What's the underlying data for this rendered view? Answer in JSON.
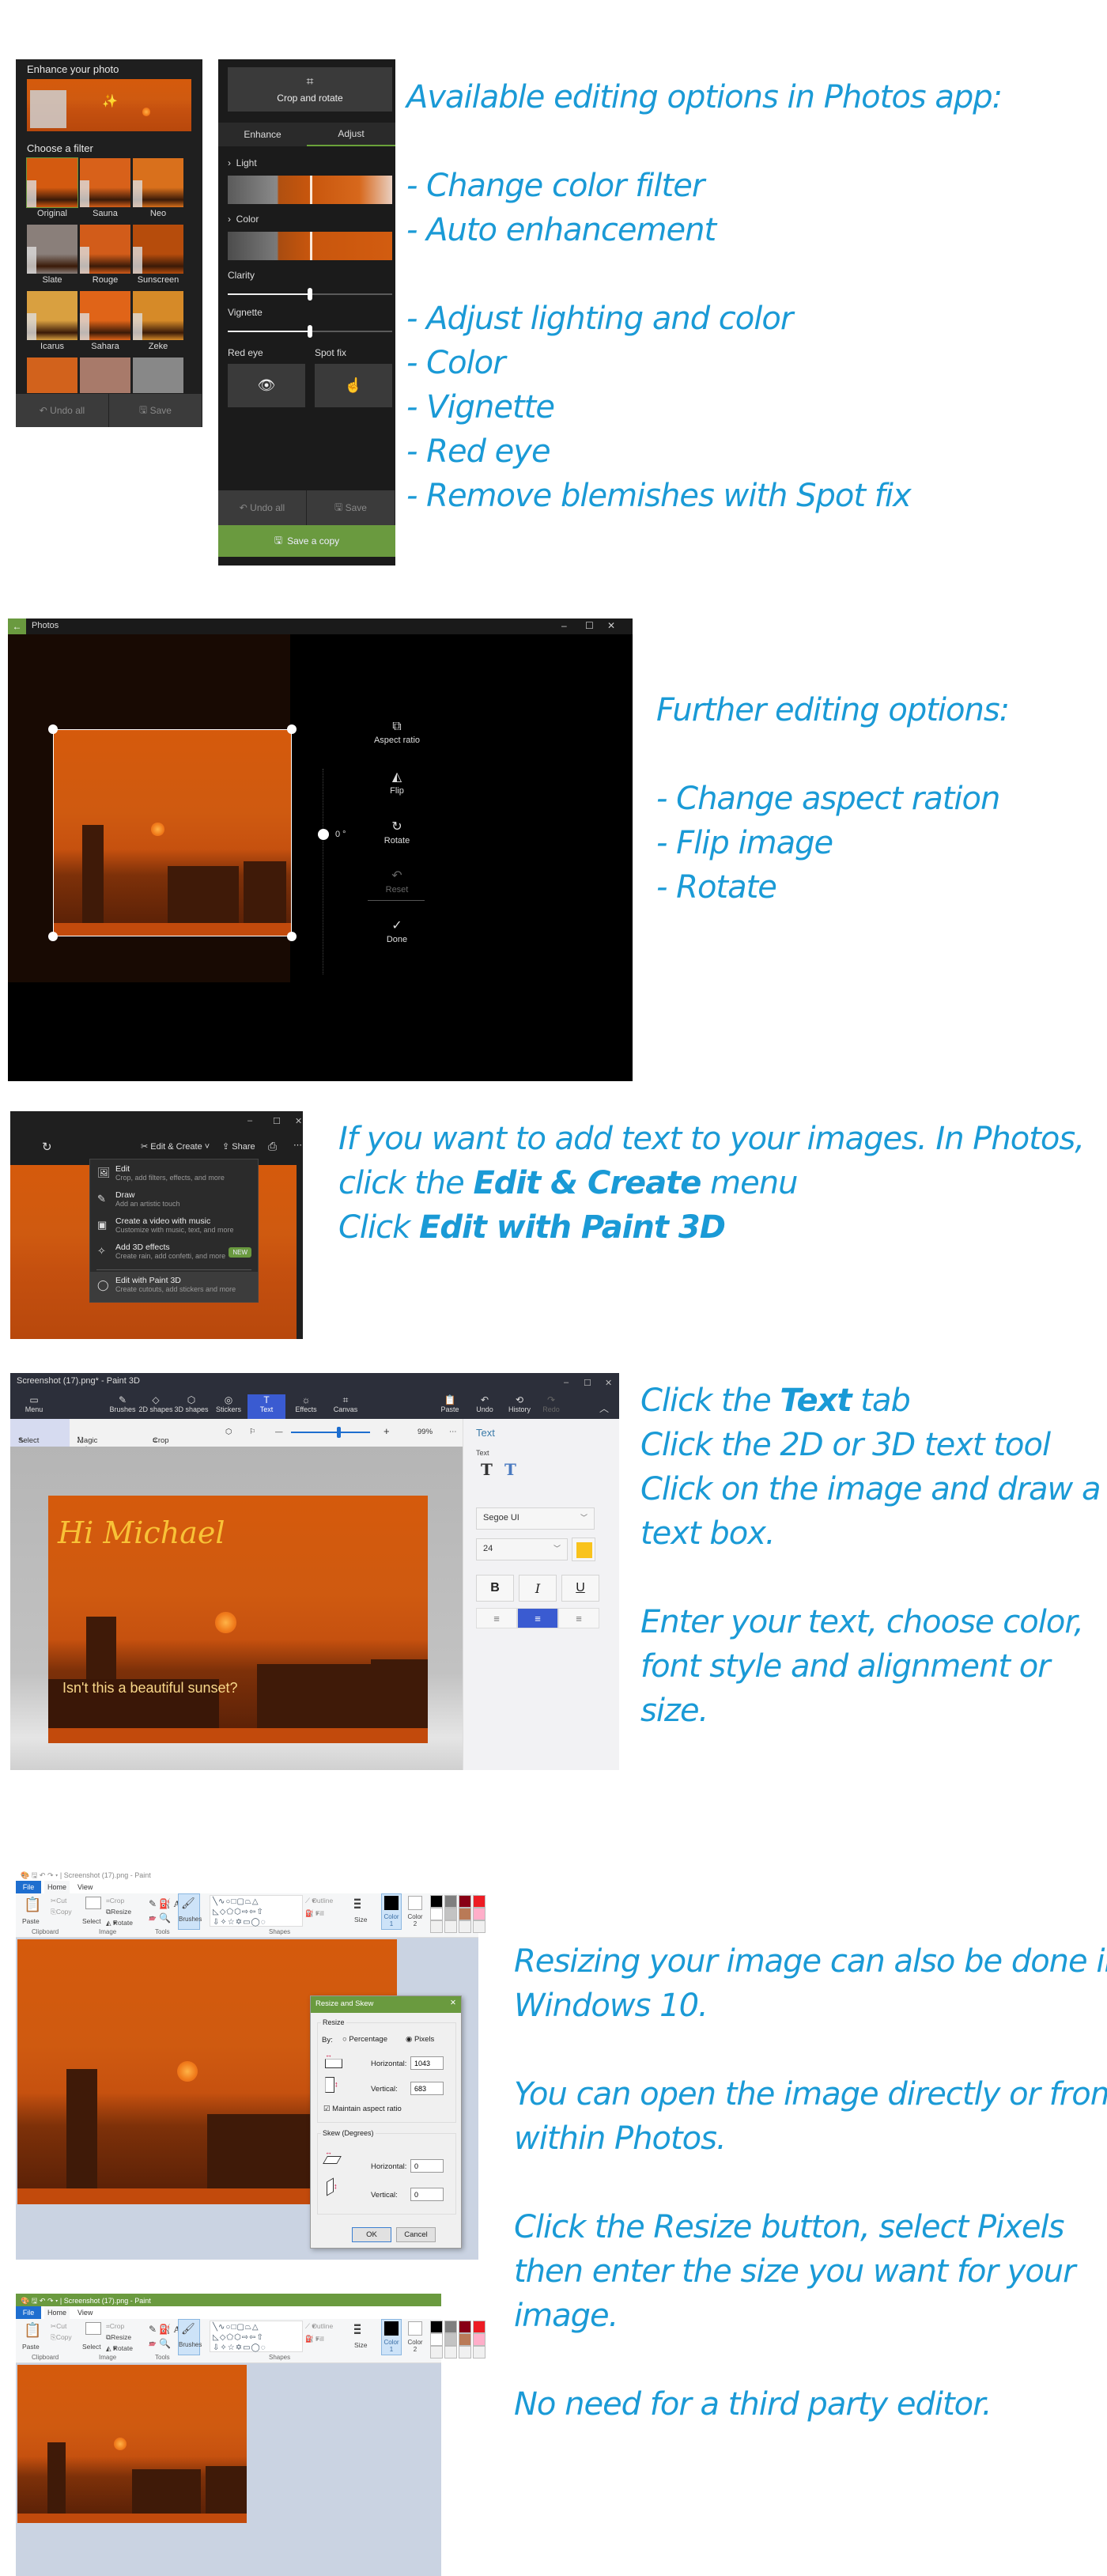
{
  "section1": {
    "filter_panel": {
      "title": "Enhance your photo",
      "choose_filter": "Choose a filter",
      "filters": [
        "Original",
        "Sauna",
        "Neo",
        "Slate",
        "Rouge",
        "Sunscreen",
        "Icarus",
        "Sahara",
        "Zeke"
      ],
      "undo_all": "Undo all",
      "save": "Save"
    },
    "adjust_panel": {
      "crop_rotate": "Crop and rotate",
      "tabs": [
        "Enhance",
        "Adjust"
      ],
      "active_tab": "Adjust",
      "light": "Light",
      "color": "Color",
      "clarity": "Clarity",
      "clarity_value": 0.5,
      "vignette": "Vignette",
      "vignette_value": 0.5,
      "red_eye": "Red eye",
      "spot_fix": "Spot fix",
      "undo_all": "Undo all",
      "save": "Save",
      "save_copy": "Save a copy"
    },
    "caption": {
      "heading": "Available editing options in Photos app:",
      "items_a": [
        "- Change color filter",
        "- Auto enhancement"
      ],
      "items_b": [
        "- Adjust lighting and color",
        "- Color",
        "- Vignette",
        "- Red eye",
        "- Remove blemishes with Spot fix"
      ]
    }
  },
  "section2": {
    "app_title": "Photos",
    "rotation": "0 °",
    "tools": [
      "Aspect ratio",
      "Flip",
      "Rotate",
      "Reset",
      "Done"
    ],
    "caption": {
      "heading": "Further editing options:",
      "items": [
        "- Change aspect ration",
        "- Flip image",
        "- Rotate"
      ]
    }
  },
  "section3": {
    "toolbar": {
      "edit_create": "Edit & Create",
      "share": "Share"
    },
    "menu": [
      {
        "title": "Edit",
        "sub": "Crop, add filters, effects, and more"
      },
      {
        "title": "Draw",
        "sub": "Add an artistic touch"
      },
      {
        "title": "Create a video with music",
        "sub": "Customize with music, text, and more"
      },
      {
        "title": "Add 3D effects",
        "sub": "Create rain, add confetti, and more",
        "badge": "NEW"
      },
      {
        "title": "Edit with Paint 3D",
        "sub": "Create cutouts, add stickers and more"
      }
    ],
    "caption": {
      "line1": "If you want to add text to your images. In Photos,",
      "line2_pre": "click the ",
      "line2_bold": "Edit & Create",
      "line2_post": " menu",
      "line3_pre": "Click ",
      "line3_bold": "Edit with Paint 3D"
    }
  },
  "section4": {
    "window_title": "Screenshot (17).png* - Paint 3D",
    "tabs": [
      "Menu",
      "Brushes",
      "2D shapes",
      "3D shapes",
      "Stickers",
      "Text",
      "Effects",
      "Canvas",
      "Paste",
      "Undo",
      "History",
      "Redo"
    ],
    "active_tab": "Text",
    "toolbar": {
      "select": "Select",
      "magic_select": "Magic select",
      "crop": "Crop",
      "zoom": "99%",
      "zoom_level": 0.6
    },
    "side": {
      "heading": "Text",
      "sub": "Text",
      "font": "Segoe UI",
      "size": "24",
      "color": "#f9c31c",
      "bold": "B",
      "italic": "I",
      "underline": "U"
    },
    "canvas": {
      "greeting": "Hi Michael",
      "message": "Isn't this a beautiful sunset?"
    },
    "caption": {
      "l1_pre": "Click the ",
      "l1_bold": "Text",
      "l1_post": " tab",
      "l2": "Click the 2D or 3D text tool",
      "l3": "Click on the image and draw a",
      "l4": "text box.",
      "l5": "Enter your text, choose color,",
      "l6": "font style and alignment or",
      "l7": "size."
    }
  },
  "section5": {
    "window_title": "Screenshot (17).png - Paint",
    "menu": {
      "file": "File",
      "home": "Home",
      "view": "View"
    },
    "ribbon": {
      "paste": "Paste",
      "cut": "Cut",
      "copy": "Copy",
      "clipboard": "Clipboard",
      "select": "Select",
      "crop": "Crop",
      "resize": "Resize",
      "rotate": "Rotate",
      "image": "Image",
      "tools": "Tools",
      "brushes": "Brushes",
      "shapes": "Shapes",
      "outline": "Outline",
      "fill": "Fill",
      "size": "Size",
      "color1": "Color 1",
      "color2": "Color 2"
    },
    "dialog": {
      "title": "Resize and Skew",
      "resize": "Resize",
      "by": "By:",
      "percentage": "Percentage",
      "pixels": "Pixels",
      "horizontal": "Horizontal:",
      "vertical": "Vertical:",
      "h_value": "1043",
      "v_value": "683",
      "maintain": "Maintain aspect ratio",
      "skew": "Skew (Degrees)",
      "skew_h": "0",
      "skew_v": "0",
      "ok": "OK",
      "cancel": "Cancel"
    },
    "caption": {
      "p1a": "Resizing your image can also be done in",
      "p1b": "Windows 10.",
      "p2a": "You can open the image directly or from",
      "p2b": "within Photos.",
      "p3a": "Click the Resize button, select Pixels",
      "p3b": "then enter the size you want for your",
      "p3c": "image.",
      "p4": "No need for a third party editor."
    }
  },
  "colors": {
    "caption": "#1a9ad6",
    "accent_green": "#6a9a3f",
    "paint3d_blue": "#3a5bd1",
    "paint_file_blue": "#1e6ecf"
  }
}
